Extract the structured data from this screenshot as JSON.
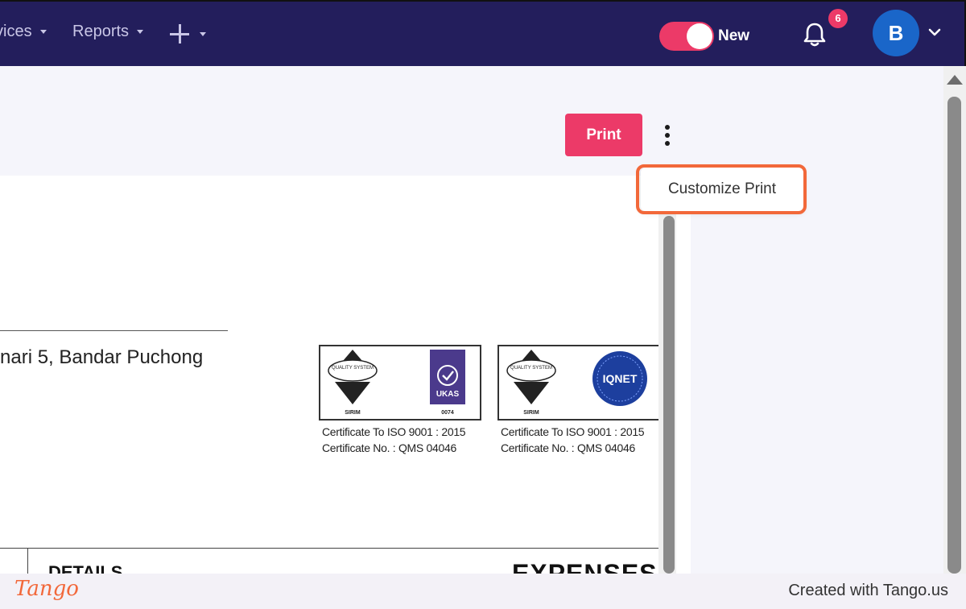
{
  "nav": {
    "items": [
      {
        "label": "vices"
      },
      {
        "label": "Reports"
      }
    ],
    "toggle_label": "New",
    "notification_count": "6",
    "avatar_initial": "B"
  },
  "toolbar": {
    "print_label": "Print"
  },
  "menu": {
    "items": [
      {
        "label": "Customize Print"
      }
    ]
  },
  "document": {
    "address_fragment": "nari 5, Bandar Puchong",
    "certificates": [
      {
        "seal_text": "QUALITY SYSTEM",
        "seal_bottom": "SIRIM",
        "logo": "UKAS",
        "logo_number": "0074",
        "line1": "Certificate To ISO 9001 : 2015",
        "line2": "Certificate No. : QMS 04046"
      },
      {
        "seal_text": "QUALITY SYSTEM",
        "seal_bottom": "SIRIM",
        "logo": "IQNET",
        "line1": "Certificate To ISO 9001 : 2015",
        "line2": "Certificate No. : QMS 04046"
      }
    ],
    "details_heading": "DETAILS",
    "expenses_heading": "EXPENSES"
  },
  "footer": {
    "logo": "Tango",
    "credit": "Created with Tango.us"
  },
  "colors": {
    "nav_bg": "#231e5c",
    "accent": "#ec3a68",
    "highlight": "#f2683a",
    "avatar": "#1a66c9"
  }
}
